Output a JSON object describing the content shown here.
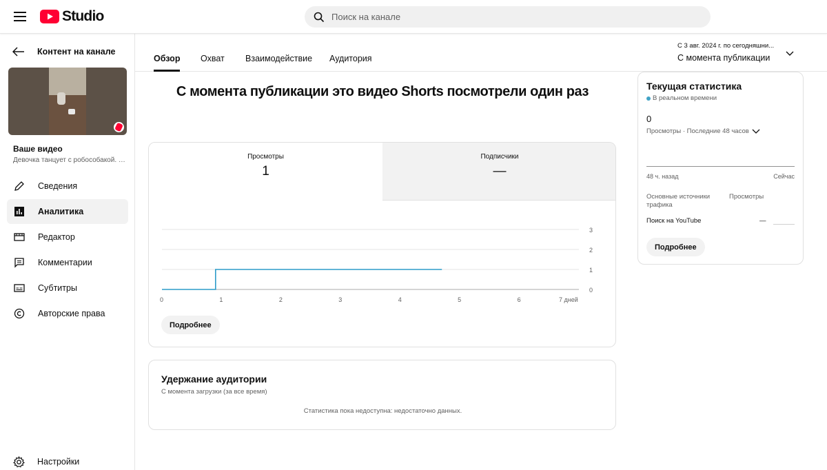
{
  "app": {
    "logo_text": "Studio",
    "brand_color": "#ff0033"
  },
  "search": {
    "placeholder": "Поиск на канале"
  },
  "sidebar": {
    "back_label": "Контент на канале",
    "your_video": "Ваше видео",
    "video_title": "Девочка танцует с робособакой. З...",
    "items": [
      {
        "label": "Сведения",
        "icon": "pencil-icon",
        "active": false
      },
      {
        "label": "Аналитика",
        "icon": "analytics-icon",
        "active": true
      },
      {
        "label": "Редактор",
        "icon": "editor-icon",
        "active": false
      },
      {
        "label": "Комментарии",
        "icon": "comments-icon",
        "active": false
      },
      {
        "label": "Субтитры",
        "icon": "subtitles-icon",
        "active": false
      },
      {
        "label": "Авторские права",
        "icon": "copyright-icon",
        "active": false
      }
    ],
    "settings_label": "Настройки"
  },
  "tabs": [
    {
      "label": "Обзор",
      "active": true
    },
    {
      "label": "Охват",
      "active": false
    },
    {
      "label": "Взаимодействие",
      "active": false
    },
    {
      "label": "Аудитория",
      "active": false
    }
  ],
  "date_range": {
    "range_text": "С 3 авг. 2024 г. по сегодняшни...",
    "selected": "С момента публикации"
  },
  "headline": "С момента публикации это видео Shorts посмотрели один раз",
  "metrics": [
    {
      "label": "Просмотры",
      "value": "1"
    },
    {
      "label": "Подписчики",
      "value": "—"
    }
  ],
  "more_label": "Подробнее",
  "chart_data": {
    "type": "line",
    "x_tick_labels": [
      "0",
      "1",
      "2",
      "3",
      "4",
      "5",
      "6",
      "7 дней"
    ],
    "y_tick_labels": [
      "3",
      "2",
      "1",
      "0"
    ],
    "ylim": [
      0,
      3
    ],
    "xlim": [
      0,
      7
    ],
    "series": [
      {
        "color": "#2c9bc9",
        "points": [
          [
            0,
            0
          ],
          [
            0.9,
            0
          ],
          [
            0.9,
            1
          ],
          [
            4.7,
            1
          ]
        ]
      }
    ],
    "grid": true
  },
  "retention": {
    "title": "Удержание аудитории",
    "subtitle": "С момента загрузки (за все время)",
    "empty_text": "Статистика пока недоступна: недостаточно данных."
  },
  "realtime": {
    "title": "Текущая статистика",
    "live_label": "В реальном времени",
    "live_color": "#41a3c6",
    "count": "0",
    "period_label": "Просмотры · Последние 48 часов",
    "ago_label": "48 ч. назад",
    "now_label": "Сейчас",
    "col_sources": "Основные источники трафика",
    "col_views": "Просмотры",
    "source_name": "Поиск на YouTube",
    "source_value": "—"
  }
}
